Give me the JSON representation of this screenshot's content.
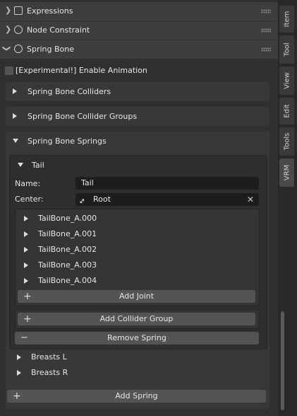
{
  "headers": [
    {
      "label": "Expressions",
      "icon": "expressions-icon"
    },
    {
      "label": "Node Constraint",
      "icon": "constraint-icon"
    },
    {
      "label": "Spring Bone",
      "icon": "spring-bone-icon"
    }
  ],
  "enable_animation_label": "[Experimental!] Enable Animation",
  "sections": {
    "colliders": "Spring Bone Colliders",
    "collider_groups": "Spring Bone Collider Groups",
    "springs": "Spring Bone Springs"
  },
  "spring": {
    "title": "Tail",
    "name_label": "Name:",
    "name_value": "Tail",
    "center_label": "Center:",
    "center_value": "Root",
    "joints": [
      "TailBone_A.000",
      "TailBone_A.001",
      "TailBone_A.002",
      "TailBone_A.003",
      "TailBone_A.004"
    ],
    "add_joint": "Add Joint",
    "add_collider_group": "Add Collider Group",
    "remove_spring": "Remove Spring"
  },
  "other_springs": [
    "Breasts L",
    "Breasts R"
  ],
  "add_spring": "Add Spring",
  "tabs": [
    "Item",
    "Tool",
    "View",
    "Edit",
    "Tools",
    "VRM"
  ],
  "active_tab": "VRM"
}
